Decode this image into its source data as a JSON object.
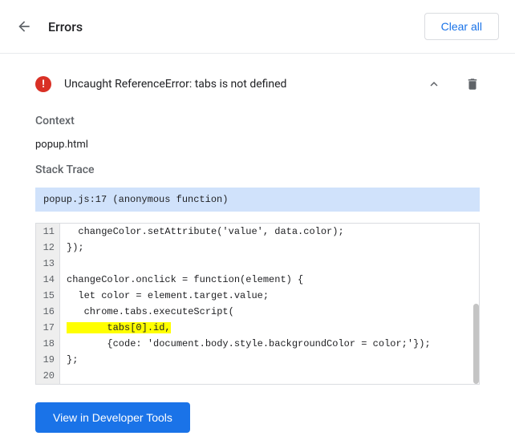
{
  "header": {
    "title": "Errors",
    "clear_all_label": "Clear all"
  },
  "error": {
    "message": "Uncaught ReferenceError: tabs is not defined",
    "context_label": "Context",
    "context_value": "popup.html",
    "stack_trace_label": "Stack Trace",
    "stack_frame": "popup.js:17 (anonymous function)"
  },
  "code": {
    "lines": [
      {
        "n": "11",
        "text": "  changeColor.setAttribute('value', data.color);"
      },
      {
        "n": "12",
        "text": "});"
      },
      {
        "n": "13",
        "text": ""
      },
      {
        "n": "14",
        "text": "changeColor.onclick = function(element) {"
      },
      {
        "n": "15",
        "text": "  let color = element.target.value;"
      },
      {
        "n": "16",
        "text": "   chrome.tabs.executeScript("
      },
      {
        "n": "17",
        "text": "       tabs[0].id,",
        "highlight": true
      },
      {
        "n": "18",
        "text": "       {code: 'document.body.style.backgroundColor = color;'});"
      },
      {
        "n": "19",
        "text": "};"
      },
      {
        "n": "20",
        "text": ""
      }
    ]
  },
  "footer": {
    "view_devtools_label": "View in Developer Tools"
  }
}
